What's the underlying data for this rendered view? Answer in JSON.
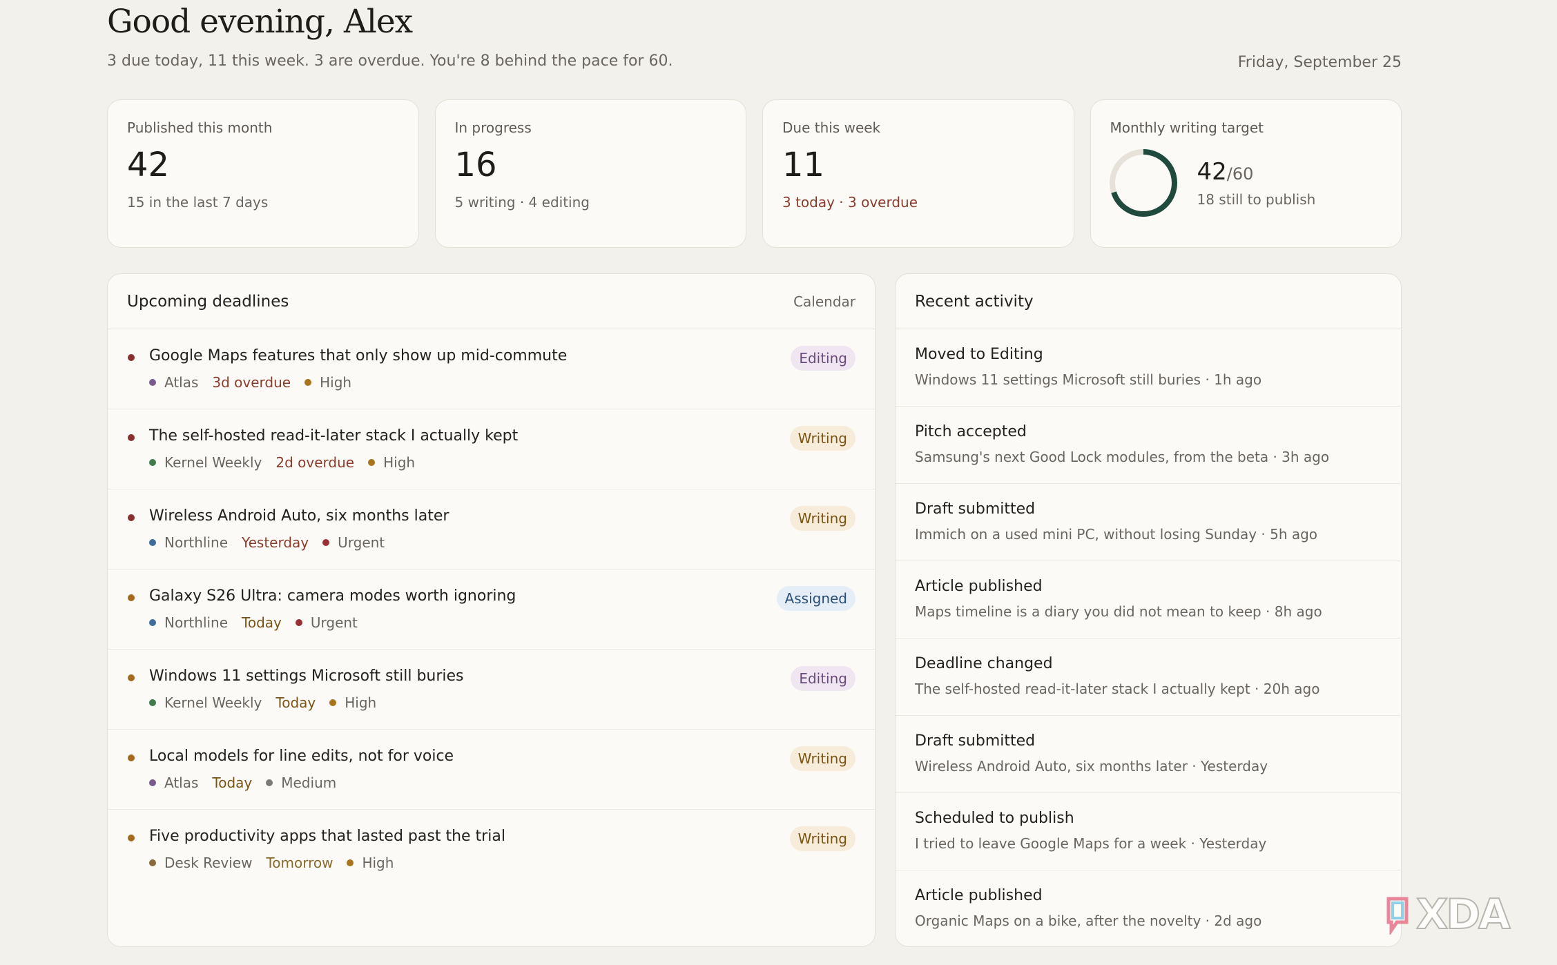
{
  "header": {
    "greeting": "Good evening, Alex",
    "summary": "3 due today, 11 this week. 3 are overdue. You're 8 behind the pace for 60.",
    "date": "Friday, September 25"
  },
  "stats": [
    {
      "label": "Published this month",
      "value": "42",
      "sub": "15 in the last 7 days",
      "warn": false
    },
    {
      "label": "In progress",
      "value": "16",
      "sub": "5 writing · 4 editing",
      "warn": false
    },
    {
      "label": "Due this week",
      "value": "11",
      "sub": "3 today · 3 overdue",
      "warn": true
    }
  ],
  "target": {
    "label": "Monthly writing target",
    "value": "42",
    "of": "/60",
    "sub": "18 still to publish",
    "progress": 0.7,
    "ring_color": "#1f4a3d",
    "track_color": "#e6e2da"
  },
  "deadlines": {
    "title": "Upcoming deadlines",
    "link": "Calendar",
    "items": [
      {
        "title": "Google Maps features that only show up mid-commute",
        "pub": "Atlas",
        "pub_color": "#7a5a8c",
        "due": "3d overdue",
        "due_color": "#8a3d2c",
        "priority": "High",
        "pri_color": "#a8741c",
        "status": "Editing",
        "dot": "#8a2f2f"
      },
      {
        "title": "The self-hosted read-it-later stack I actually kept",
        "pub": "Kernel Weekly",
        "pub_color": "#3f7a4a",
        "due": "2d overdue",
        "due_color": "#8a3d2c",
        "priority": "High",
        "pri_color": "#a8741c",
        "status": "Writing",
        "dot": "#8a2f2f"
      },
      {
        "title": "Wireless Android Auto, six months later",
        "pub": "Northline",
        "pub_color": "#3d6c9a",
        "due": "Yesterday",
        "due_color": "#8a3d2c",
        "priority": "Urgent",
        "pri_color": "#9a2f35",
        "status": "Writing",
        "dot": "#8a2f2f"
      },
      {
        "title": "Galaxy S26 Ultra: camera modes worth ignoring",
        "pub": "Northline",
        "pub_color": "#3d6c9a",
        "due": "Today",
        "due_color": "#7a5414",
        "priority": "Urgent",
        "pri_color": "#9a2f35",
        "status": "Assigned",
        "dot": "#a56a1e"
      },
      {
        "title": "Windows 11 settings Microsoft still buries",
        "pub": "Kernel Weekly",
        "pub_color": "#3f7a4a",
        "due": "Today",
        "due_color": "#7a5414",
        "priority": "High",
        "pri_color": "#a8741c",
        "status": "Editing",
        "dot": "#a56a1e"
      },
      {
        "title": "Local models for line edits, not for voice",
        "pub": "Atlas",
        "pub_color": "#7a5a8c",
        "due": "Today",
        "due_color": "#7a5414",
        "priority": "Medium",
        "pri_color": "#7c7a76",
        "status": "Writing",
        "dot": "#a56a1e"
      },
      {
        "title": "Five productivity apps that lasted past the trial",
        "pub": "Desk Review",
        "pub_color": "#8a6a3a",
        "due": "Tomorrow",
        "due_color": "#8a6a2a",
        "priority": "High",
        "pri_color": "#a8741c",
        "status": "Writing",
        "dot": "#a56a1e"
      }
    ]
  },
  "status_styles": {
    "Editing": {
      "bg": "#efe6f2",
      "fg": "#6a4a7a"
    },
    "Writing": {
      "bg": "#f7ecd9",
      "fg": "#7a5414"
    },
    "Assigned": {
      "bg": "#e5edf6",
      "fg": "#2c4f75"
    }
  },
  "activity": {
    "title": "Recent activity",
    "items": [
      {
        "title": "Moved to Editing",
        "sub": "Windows 11 settings Microsoft still buries · 1h ago"
      },
      {
        "title": "Pitch accepted",
        "sub": "Samsung's next Good Lock modules, from the beta · 3h ago"
      },
      {
        "title": "Draft submitted",
        "sub": "Immich on a used mini PC, without losing Sunday · 5h ago"
      },
      {
        "title": "Article published",
        "sub": "Maps timeline is a diary you did not mean to keep · 8h ago"
      },
      {
        "title": "Deadline changed",
        "sub": "The self-hosted read-it-later stack I actually kept · 20h ago"
      },
      {
        "title": "Draft submitted",
        "sub": "Wireless Android Auto, six months later · Yesterday"
      },
      {
        "title": "Scheduled to publish",
        "sub": "I tried to leave Google Maps for a week · Yesterday"
      },
      {
        "title": "Article published",
        "sub": "Organic Maps on a bike, after the novelty · 2d ago"
      }
    ]
  },
  "watermark": {
    "text": "XDA",
    "icon": "xda-logo-icon"
  }
}
